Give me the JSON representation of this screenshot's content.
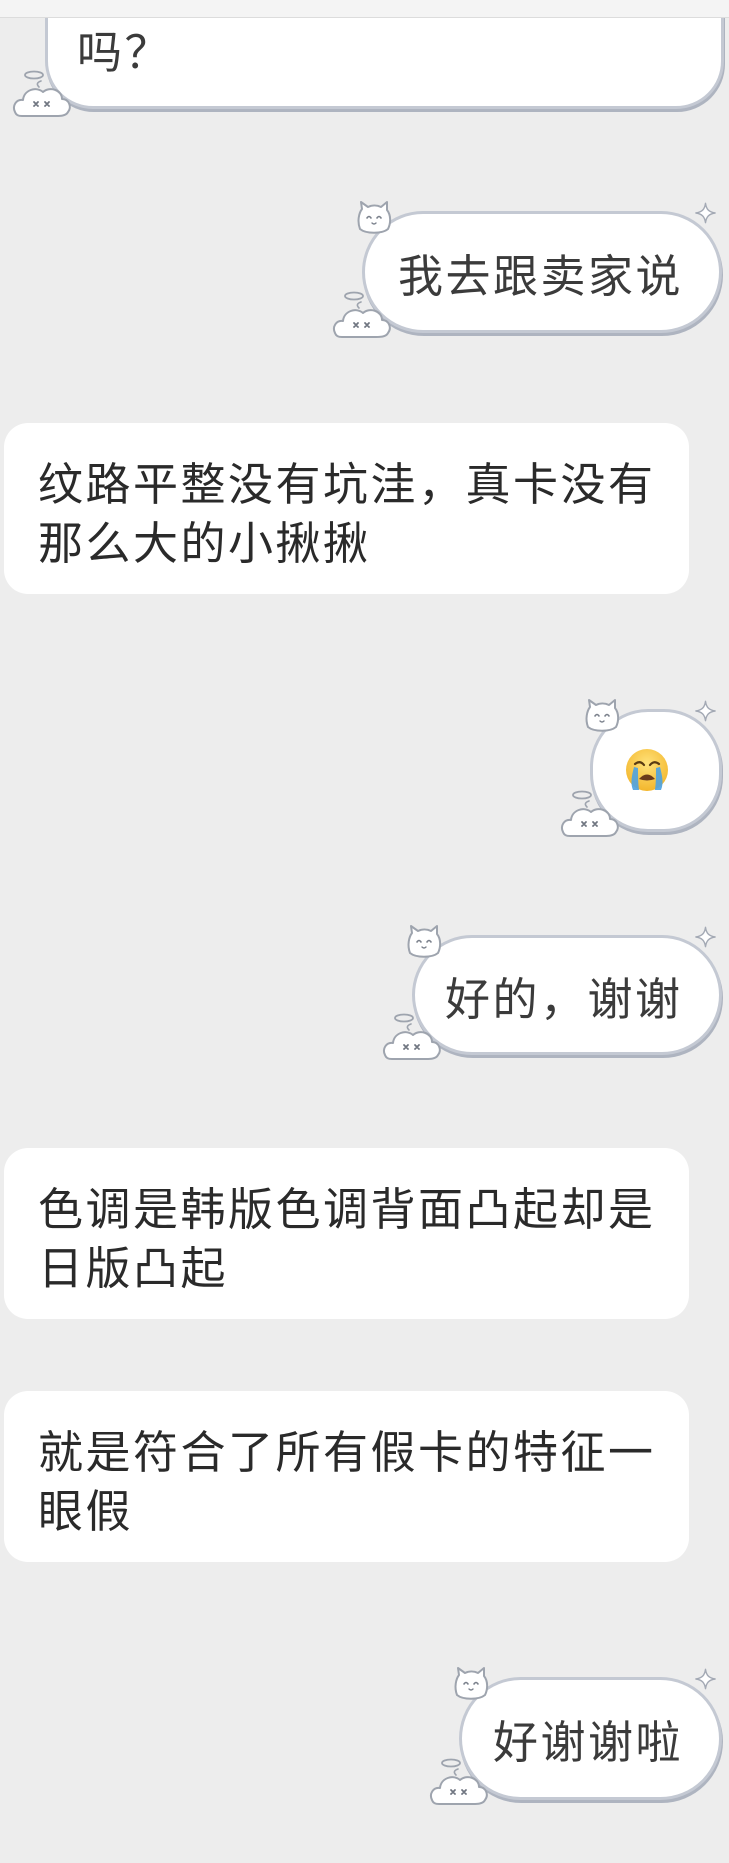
{
  "theme": {
    "background": "#ededed",
    "bubble_fill": "#ffffff",
    "bubble_border": "#c4c9d3",
    "text_color": "#2a2a2a"
  },
  "decor_icons": {
    "top_left": "cat-face-icon",
    "top_right": "sparkle-icon",
    "bottom_left": "halo-ghost-icon"
  },
  "messages": [
    {
      "outgoing": true,
      "text": "吗？"
    },
    {
      "outgoing": true,
      "text": "我去跟卖家说"
    },
    {
      "outgoing": false,
      "lines": [
        "纹路平整没有坑洼，真卡没有",
        "那么大的小揪揪"
      ]
    },
    {
      "outgoing": true,
      "emoji": "loudly-crying-face-icon"
    },
    {
      "outgoing": true,
      "text": "好的，谢谢"
    },
    {
      "outgoing": false,
      "lines": [
        "色调是韩版色调背面凸起却是",
        "日版凸起"
      ]
    },
    {
      "outgoing": false,
      "lines": [
        "就是符合了所有假卡的特征一",
        "眼假"
      ]
    },
    {
      "outgoing": true,
      "text": "好谢谢啦"
    }
  ]
}
